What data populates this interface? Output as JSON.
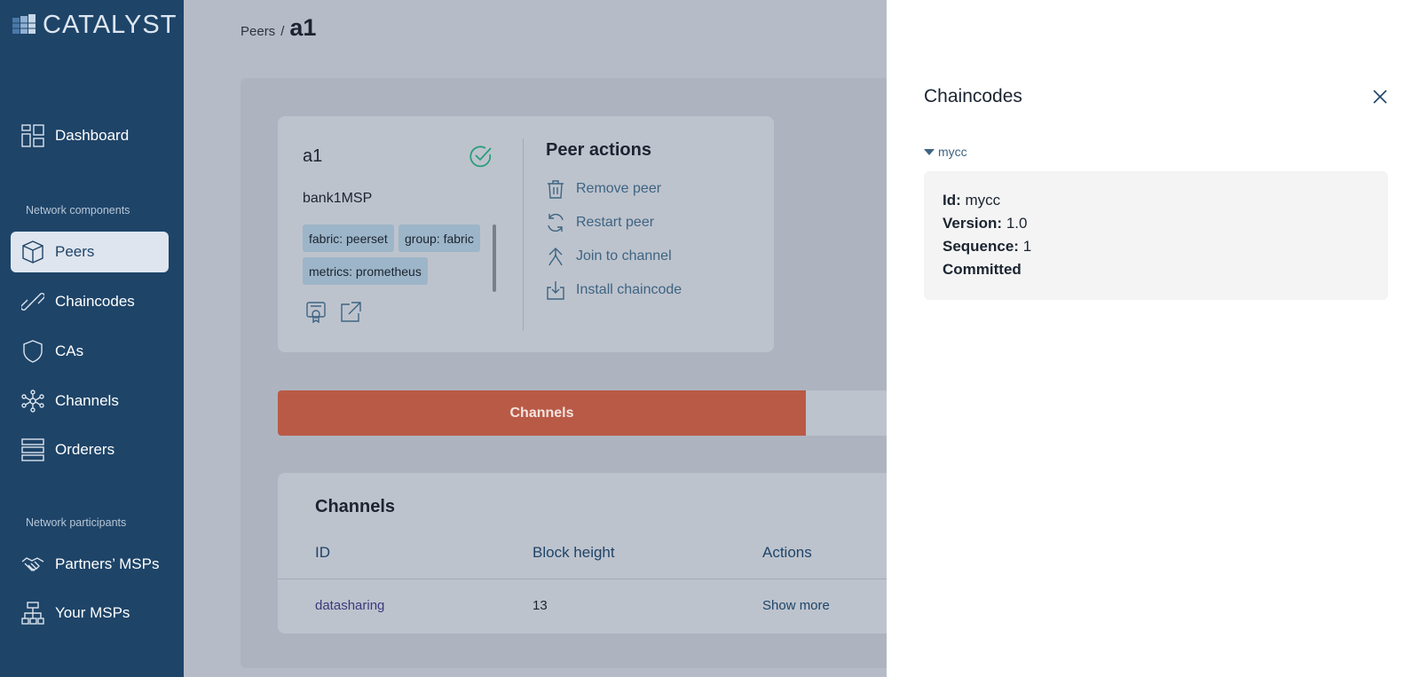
{
  "app": {
    "logo_text": "CATALYST"
  },
  "sidebar": {
    "items": [
      {
        "label": "Dashboard"
      },
      {
        "label": "Peers"
      },
      {
        "label": "Chaincodes"
      },
      {
        "label": "CAs"
      },
      {
        "label": "Channels"
      },
      {
        "label": "Orderers"
      },
      {
        "label": "Partners’ MSPs"
      },
      {
        "label": "Your MSPs"
      }
    ],
    "section_network_components": "Network components",
    "section_network_participants": "Network participants"
  },
  "breadcrumb": {
    "parent": "Peers",
    "separator": "/",
    "current": "a1"
  },
  "peer": {
    "name": "a1",
    "msp": "bank1MSP",
    "tags": [
      "fabric: peerset",
      "group: fabric",
      "metrics: prometheus"
    ],
    "status_color": "#2a9d7c"
  },
  "peer_actions": {
    "title": "Peer actions",
    "items": [
      {
        "label": "Remove peer",
        "icon": "trash-icon"
      },
      {
        "label": "Restart peer",
        "icon": "refresh-icon"
      },
      {
        "label": "Join to channel",
        "icon": "join-icon"
      },
      {
        "label": "Install chaincode",
        "icon": "download-icon"
      }
    ]
  },
  "tabs": {
    "active_label": "Channels",
    "active_color": "#b95a46"
  },
  "channels": {
    "title": "Channels",
    "columns": [
      "ID",
      "Block height",
      "Actions"
    ],
    "rows": [
      {
        "id": "datasharing",
        "block_height": "13",
        "action": "Show more"
      }
    ]
  },
  "drawer": {
    "title": "Chaincodes",
    "chaincode": {
      "name": "mycc",
      "id_label": "Id:",
      "id_value": "mycc",
      "version_label": "Version:",
      "version_value": "1.0",
      "sequence_label": "Sequence:",
      "sequence_value": "1",
      "status": "Committed"
    }
  }
}
